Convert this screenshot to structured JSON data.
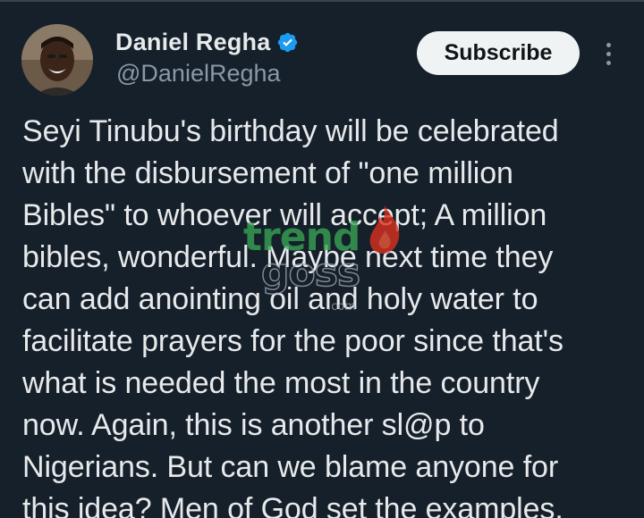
{
  "author": {
    "display_name": "Daniel Regha",
    "handle": "@DanielRegha",
    "verified": true
  },
  "actions": {
    "subscribe_label": "Subscribe"
  },
  "tweet": {
    "lines": [
      "Seyi Tinubu's birthday will be celebrated",
      "with the disbursement of \"one million",
      "Bibles\" to whoever will accept; A million",
      "bibles, wonderful. Maybe next time they",
      "can add anointing oil and holy water to",
      "facilitate prayers for the poor since that's",
      "what is needed the most in the country",
      "now. Again, this is another sl@p to",
      "Nigerians. But can we blame anyone for",
      "this idea? Men of God set the examples."
    ]
  },
  "watermark": {
    "line1": "trend",
    "line2": "goss",
    "suffix": ".com"
  },
  "icons": {
    "verified": "verified-badge-icon",
    "more": "more-options-icon"
  },
  "colors": {
    "background": "#15202b",
    "text_primary": "#e7e9ea",
    "text_secondary": "#8b98a5",
    "verified": "#1d9bf0",
    "button_bg": "#eff3f4",
    "button_text": "#0f1419"
  }
}
